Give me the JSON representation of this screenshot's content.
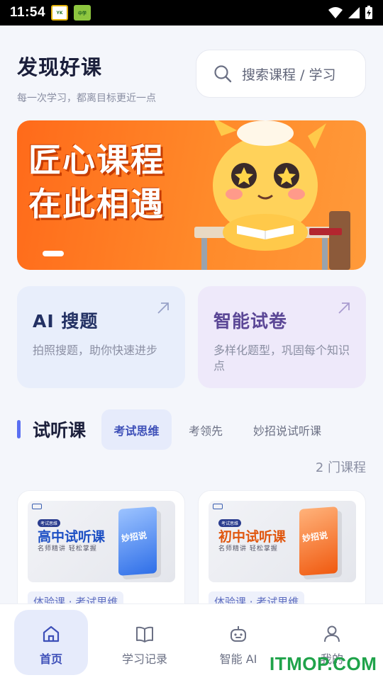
{
  "status_bar": {
    "time": "11:54"
  },
  "header": {
    "title": "发现好课",
    "subtitle": "每一次学习，都离目标更近一点"
  },
  "search": {
    "placeholder": "搜索课程 / 学习"
  },
  "banner": {
    "line1": "匠心课程",
    "line2": "在此相遇",
    "slide_index": 1
  },
  "features": [
    {
      "title": "AI 搜题",
      "desc": "拍照搜题，助你快速进步",
      "icon": "arrow-up-right-icon"
    },
    {
      "title": "智能试卷",
      "desc": "多样化题型，巩固每个知识点",
      "icon": "arrow-up-right-icon"
    }
  ],
  "section": {
    "title": "试听课",
    "tabs": [
      "考试思维",
      "考领先",
      "妙招说试听课"
    ],
    "active_tab": "考试思维",
    "count": "2 门课程"
  },
  "courses": [
    {
      "thumb_title": "高中试听课",
      "thumb_sub": "名师精讲 轻松掌握",
      "thumb_tag": "考试思维",
      "book_label": "妙招说",
      "book_color": "#3f7ff0",
      "title_color": "#1c4fc4",
      "tag": "体验课 · 考试思维"
    },
    {
      "thumb_title": "初中试听课",
      "thumb_sub": "名师精讲 轻松掌握",
      "thumb_tag": "考试思维",
      "book_label": "妙招说",
      "book_color": "#ff6a20",
      "title_color": "#e0560e",
      "tag": "体验课 · 考试思维"
    }
  ],
  "bottom_nav": [
    {
      "label": "首页",
      "icon": "home-icon",
      "active": true
    },
    {
      "label": "学习记录",
      "icon": "book-icon",
      "active": false
    },
    {
      "label": "智能 AI",
      "icon": "robot-icon",
      "active": false
    },
    {
      "label": "我的",
      "icon": "user-icon",
      "active": false
    }
  ],
  "watermark": "ITMOP.COM",
  "colors": {
    "accent": "#3d4fb8",
    "banner": "#ff7a1f",
    "watermark": "#1fa34a"
  }
}
